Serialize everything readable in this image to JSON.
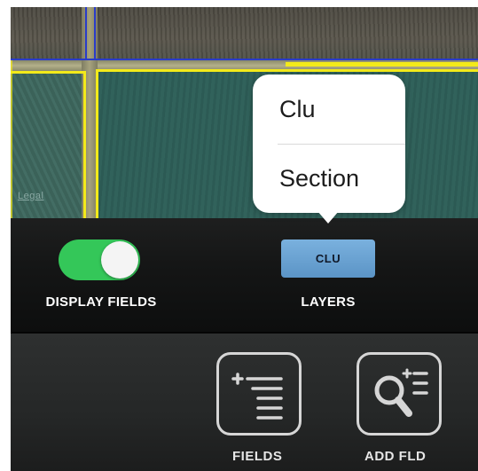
{
  "map": {
    "legal_link": "Legal"
  },
  "toolbar": {
    "display_fields": {
      "label": "DISPLAY FIELDS",
      "toggle_on": true,
      "toggle_color": "#34c759"
    },
    "layers": {
      "label": "LAYERS",
      "selected_button_label": "CLU",
      "button_color": "#6aa3d4"
    }
  },
  "layers_popover": {
    "options": [
      "Clu",
      "Section"
    ]
  },
  "bottom_bar": {
    "buttons": [
      {
        "label": "FIELDS",
        "icon": "list-icon"
      },
      {
        "label": "ADD FLD",
        "icon": "search-add-icon"
      }
    ]
  },
  "colors": {
    "field_boundary": "#f3ea1a",
    "selected_boundary": "#2a3cc9"
  }
}
